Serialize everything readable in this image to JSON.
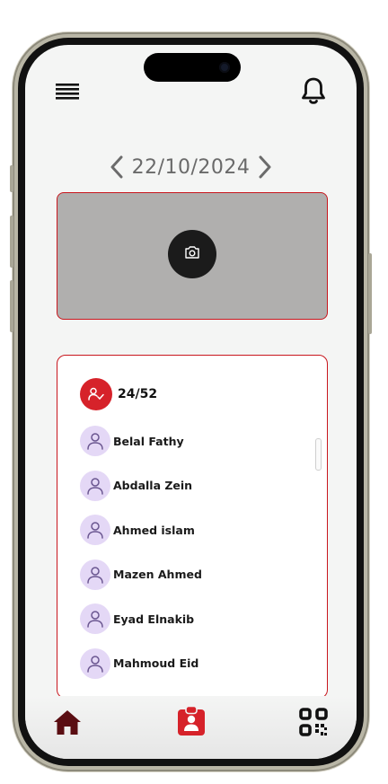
{
  "header": {
    "menu_icon": "hamburger-menu-icon",
    "bell_icon": "bell-icon"
  },
  "date_nav": {
    "date": "22/10/2024",
    "prev_icon": "chevron-left-icon",
    "next_icon": "chevron-right-icon"
  },
  "photo": {
    "camera_icon": "camera-icon"
  },
  "attendance": {
    "count": "24/52",
    "count_icon": "user-check-icon",
    "students": [
      {
        "name": "Belal Fathy"
      },
      {
        "name": "Abdalla Zein"
      },
      {
        "name": "Ahmed islam"
      },
      {
        "name": "Mazen Ahmed"
      },
      {
        "name": "Eyad Elnakib"
      },
      {
        "name": "Mahmoud Eid"
      }
    ]
  },
  "bottom_nav": {
    "home_icon": "home-icon",
    "attendance_icon": "clipboard-user-icon",
    "qr_icon": "qr-code-icon"
  },
  "colors": {
    "accent_red": "#d6222a",
    "dark_red": "#5a0d12",
    "avatar_bg": "#e4d8f6"
  }
}
